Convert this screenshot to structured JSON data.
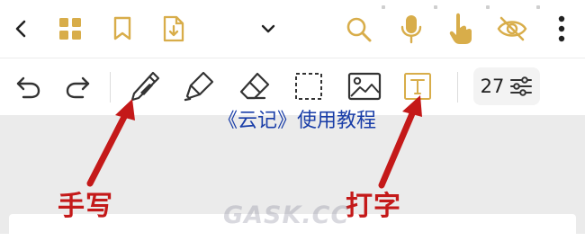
{
  "colors": {
    "gold": "#d8ad4a",
    "ink": "#333333",
    "annotation_red": "#c41919",
    "title_blue": "#1a3ea8",
    "canvas_bg": "#ebebeb"
  },
  "top_bar": {
    "icons": [
      "back-icon",
      "grid-icon",
      "bookmark-icon",
      "export-icon",
      "chevron-down-icon",
      "search-icon",
      "microphone-icon",
      "touch-icon",
      "eye-off-icon",
      "more-vertical-icon"
    ]
  },
  "toolbar": {
    "icons": [
      "undo-icon",
      "redo-icon",
      "pen-icon",
      "highlighter-icon",
      "eraser-icon",
      "lasso-select-icon",
      "image-icon",
      "text-icon",
      "settings-sliders-icon"
    ],
    "font_size": "27"
  },
  "overlay": {
    "title": "《云记》使用教程",
    "handwriting_label": "手写",
    "typing_label": "打字",
    "watermark": "GASK.CC"
  }
}
